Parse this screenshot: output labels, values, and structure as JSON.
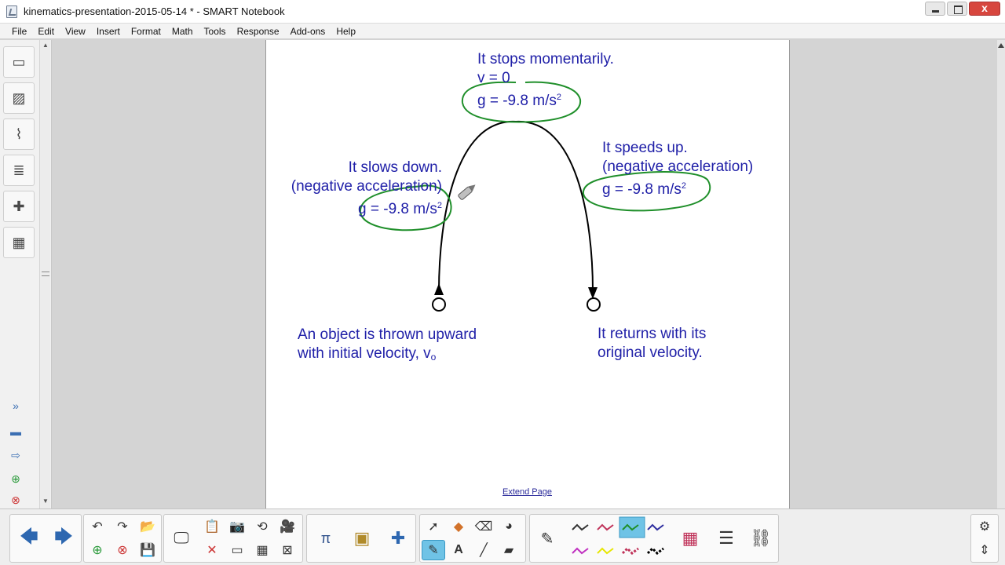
{
  "window": {
    "title": "kinematics-presentation-2015-05-14 * - SMART Notebook",
    "close_glyph": "x"
  },
  "menu": [
    "File",
    "Edit",
    "View",
    "Insert",
    "Format",
    "Math",
    "Tools",
    "Response",
    "Add-ons",
    "Help"
  ],
  "sidebar": {
    "tabs": [
      {
        "icon": "page-sorter-icon",
        "glyph": "▭"
      },
      {
        "icon": "gallery-icon",
        "glyph": "▨"
      },
      {
        "icon": "attachments-icon",
        "glyph": "⌇"
      },
      {
        "icon": "properties-icon",
        "glyph": "≣"
      },
      {
        "icon": "add-ons-icon",
        "glyph": "✚"
      },
      {
        "icon": "lesson-activity-icon",
        "glyph": "▦"
      }
    ]
  },
  "slide": {
    "top": {
      "line1": "It stops momentarily.",
      "line2": "v = 0",
      "line3": "g = -9.8 m/s",
      "sup": "2"
    },
    "left": {
      "line1": "It slows down.",
      "line2": "(negative acceleration)",
      "line3": "g = -9.8 m/s",
      "sup": "2"
    },
    "right": {
      "line1": "It speeds up.",
      "line2": "(negative acceleration)",
      "line3": "g = -9.8 m/s",
      "sup": "2"
    },
    "bottom_left": {
      "line1": "An object is thrown upward",
      "line2": "with initial velocity, v",
      "sub": "o"
    },
    "bottom_right": {
      "line1": "It returns with its",
      "line2": "original velocity."
    },
    "extend_page": "Extend Page",
    "colors": {
      "text": "#2020a8",
      "ink_green": "#1f8f2a",
      "curve": "#000000"
    }
  },
  "toolbar": {
    "nav": [
      {
        "name": "previous-page-button",
        "icon": "arrow-left-icon",
        "glyph": "🡄"
      },
      {
        "name": "next-page-button",
        "icon": "arrow-right-icon",
        "glyph": "🡆"
      }
    ],
    "edit": [
      {
        "name": "undo-button",
        "icon": "undo-icon",
        "glyph": "↶"
      },
      {
        "name": "redo-button",
        "icon": "redo-icon",
        "glyph": "↷"
      },
      {
        "name": "open-file-button",
        "icon": "folder-icon",
        "glyph": "📂"
      },
      {
        "name": "add-page-button",
        "icon": "add-page-icon",
        "glyph": "⊕"
      },
      {
        "name": "delete-page-button",
        "icon": "delete-page-icon",
        "glyph": "⊗"
      },
      {
        "name": "save-button",
        "icon": "save-icon",
        "glyph": "💾"
      }
    ],
    "view": [
      {
        "name": "screen-shade-button",
        "icon": "monitor-icon",
        "glyph": "🖵"
      },
      {
        "name": "paste-button",
        "icon": "clipboard-icon",
        "glyph": "📋"
      },
      {
        "name": "capture-button",
        "icon": "camera-icon",
        "glyph": "📷"
      },
      {
        "name": "rotate-button",
        "icon": "rotate-icon",
        "glyph": "⟲"
      },
      {
        "name": "document-camera-button",
        "icon": "doc-camera-icon",
        "glyph": "🎥"
      },
      {
        "name": "delete-button",
        "icon": "delete-x-icon",
        "glyph": "✕"
      },
      {
        "name": "display-button",
        "icon": "display-icon",
        "glyph": "▭"
      },
      {
        "name": "table-button",
        "icon": "table-icon",
        "glyph": "▦"
      },
      {
        "name": "fullscreen-button",
        "icon": "close-box-icon",
        "glyph": "⊠"
      }
    ],
    "addons": [
      {
        "name": "math-tools-button",
        "icon": "pi-icon",
        "glyph": "π"
      },
      {
        "name": "response-button",
        "icon": "clipboard-tool-icon",
        "glyph": "▣"
      },
      {
        "name": "addons-button",
        "icon": "puzzle-icon",
        "glyph": "✚"
      }
    ],
    "tools": [
      {
        "name": "select-button",
        "icon": "cursor-icon",
        "glyph": "➚"
      },
      {
        "name": "shapes-button",
        "icon": "shapes-icon",
        "glyph": "◆"
      },
      {
        "name": "eraser-button",
        "icon": "eraser-icon",
        "glyph": "⌫"
      },
      {
        "name": "fill-button",
        "icon": "fill-icon",
        "glyph": "◕"
      },
      {
        "name": "creative-pen-button",
        "icon": "creative-pen-icon",
        "glyph": "✎"
      },
      {
        "name": "text-button",
        "icon": "text-A-icon",
        "glyph": "A"
      },
      {
        "name": "line-button",
        "icon": "line-icon",
        "glyph": "╱"
      },
      {
        "name": "magic-eraser-button",
        "icon": "eraser2-icon",
        "glyph": "▰"
      }
    ],
    "pens": {
      "pen_glyph": "✎",
      "colors": [
        "#333333",
        "#c0335a",
        "#1f8f2a",
        "#3030a0",
        "#c030c0",
        "#e6e600",
        "#c0335a",
        "#000000"
      ]
    },
    "props": [
      {
        "name": "color-palette-button",
        "icon": "palette-icon",
        "glyph": "▦"
      },
      {
        "name": "line-style-button",
        "icon": "line-style-icon",
        "glyph": "☰"
      },
      {
        "name": "link-button",
        "icon": "link-icon",
        "glyph": "⛓"
      }
    ],
    "right": [
      {
        "name": "settings-button",
        "icon": "gear-icon",
        "glyph": "⚙"
      },
      {
        "name": "move-toolbar-button",
        "icon": "updown-arrow-icon",
        "glyph": "⇕"
      }
    ]
  }
}
